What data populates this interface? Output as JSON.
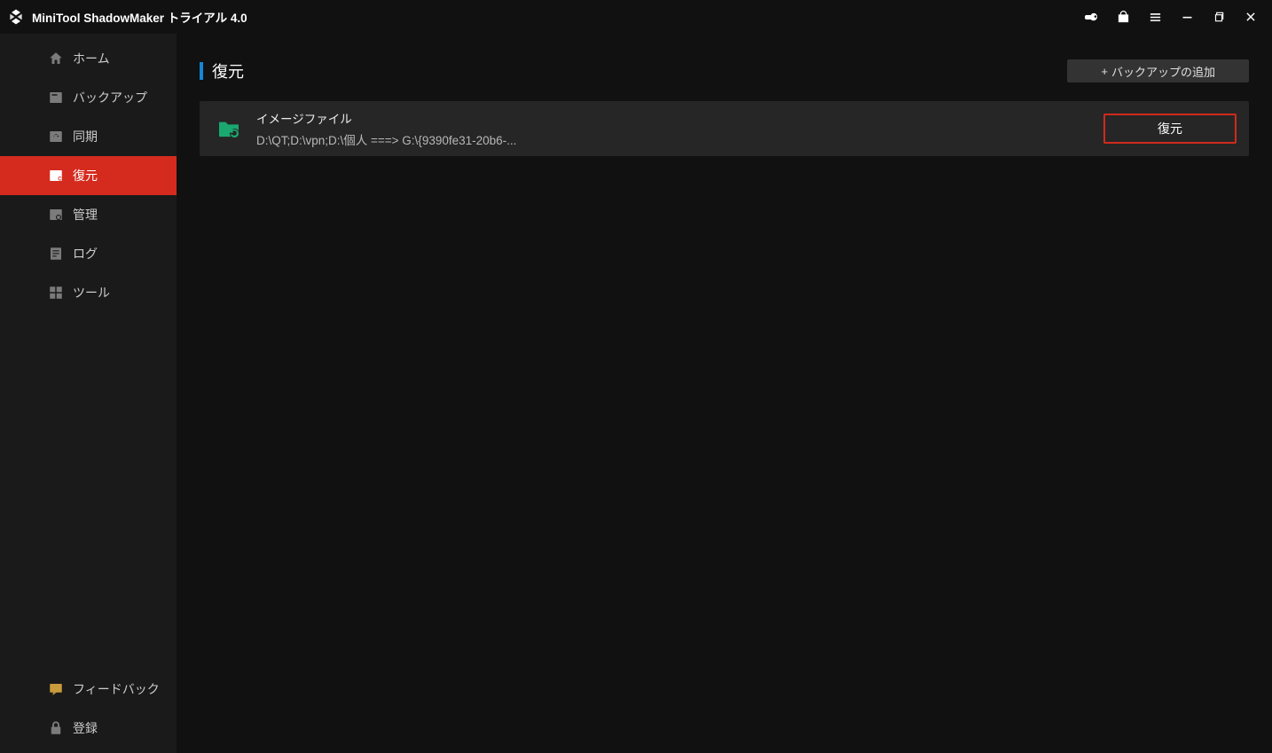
{
  "titlebar": {
    "title": "MiniTool ShadowMaker トライアル 4.0",
    "icons": {
      "key": "key-icon",
      "shop": "shop-icon",
      "menu": "menu-icon",
      "minimize": "minimize-icon",
      "maximize": "maximize-icon",
      "close": "close-icon"
    }
  },
  "sidebar": {
    "items": [
      {
        "label": "ホーム",
        "icon": "home-icon"
      },
      {
        "label": "バックアップ",
        "icon": "backup-icon"
      },
      {
        "label": "同期",
        "icon": "sync-icon"
      },
      {
        "label": "復元",
        "icon": "restore-icon",
        "active": true
      },
      {
        "label": "管理",
        "icon": "manage-icon"
      },
      {
        "label": "ログ",
        "icon": "log-icon"
      },
      {
        "label": "ツール",
        "icon": "tools-icon"
      }
    ],
    "footer": [
      {
        "label": "フィードバック",
        "icon": "feedback-icon"
      },
      {
        "label": "登録",
        "icon": "register-icon"
      }
    ]
  },
  "page": {
    "title": "復元",
    "add_backup_label": "バックアップの追加"
  },
  "list": {
    "rows": [
      {
        "title": "イメージファイル",
        "path": "D:\\QT;D:\\vpn;D:\\個人  ===>  G:\\{9390fe31-20b6-...",
        "restore_label": "復元"
      }
    ]
  }
}
